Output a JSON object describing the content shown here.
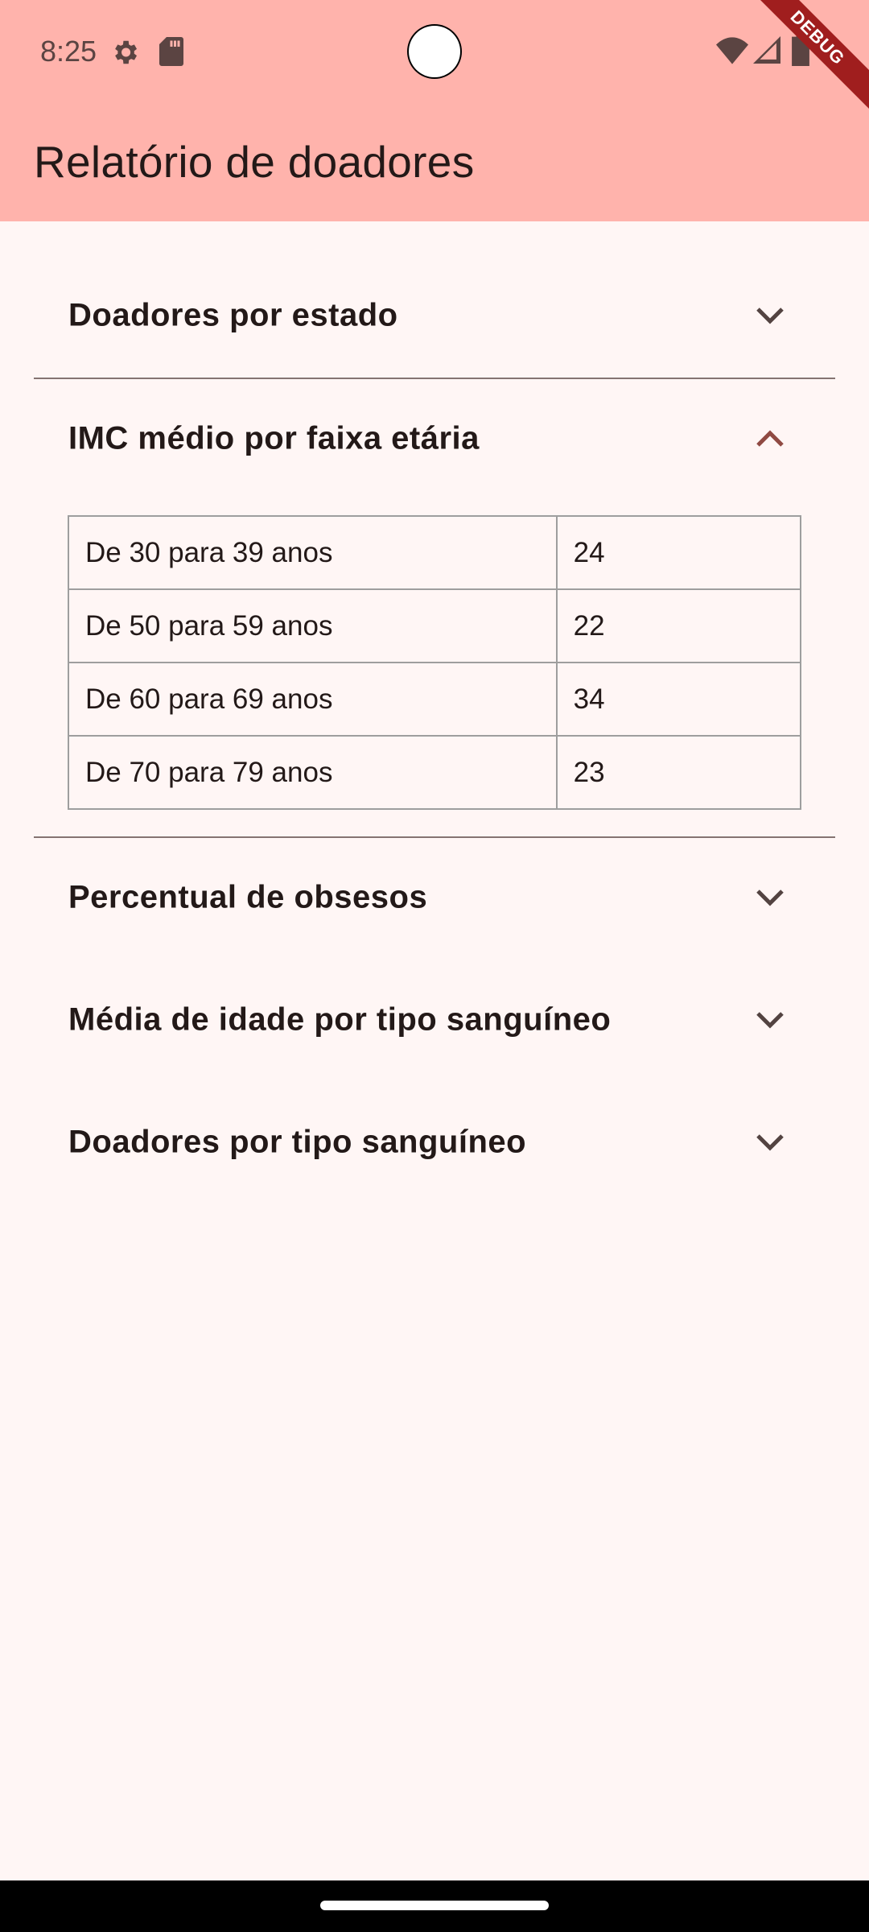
{
  "status_bar": {
    "time": "8:25",
    "icons": [
      "settings-gear-icon",
      "sd-card-icon",
      "wifi-icon",
      "cell-signal-icon",
      "battery-icon"
    ]
  },
  "app_bar": {
    "title": "Relatório de doadores",
    "background_color": "#ffb3ac"
  },
  "debug_banner": {
    "label": "DEBUG"
  },
  "panels": [
    {
      "title": "Doadores por estado",
      "expanded": false,
      "icon": "chevron-down-icon"
    },
    {
      "title": "IMC médio por faixa etária",
      "expanded": true,
      "icon": "chevron-up-icon"
    },
    {
      "title": "Percentual de obsesos",
      "expanded": false,
      "icon": "chevron-down-icon"
    },
    {
      "title": "Média de idade por tipo sanguíneo",
      "expanded": false,
      "icon": "chevron-down-icon"
    },
    {
      "title": "Doadores por tipo sanguíneo",
      "expanded": false,
      "icon": "chevron-down-icon"
    }
  ],
  "imc_table": {
    "rows": [
      {
        "range": "De 30 para 39 anos",
        "value": "24"
      },
      {
        "range": "De 50 para 59 anos",
        "value": "22"
      },
      {
        "range": "De 60 para 69 anos",
        "value": "34"
      },
      {
        "range": "De 70 para 79 anos",
        "value": "23"
      }
    ]
  },
  "colors": {
    "background": "#fff6f5",
    "expanded_chevron": "#904a43",
    "collapsed_chevron": "#534341",
    "divider": "#857371"
  }
}
